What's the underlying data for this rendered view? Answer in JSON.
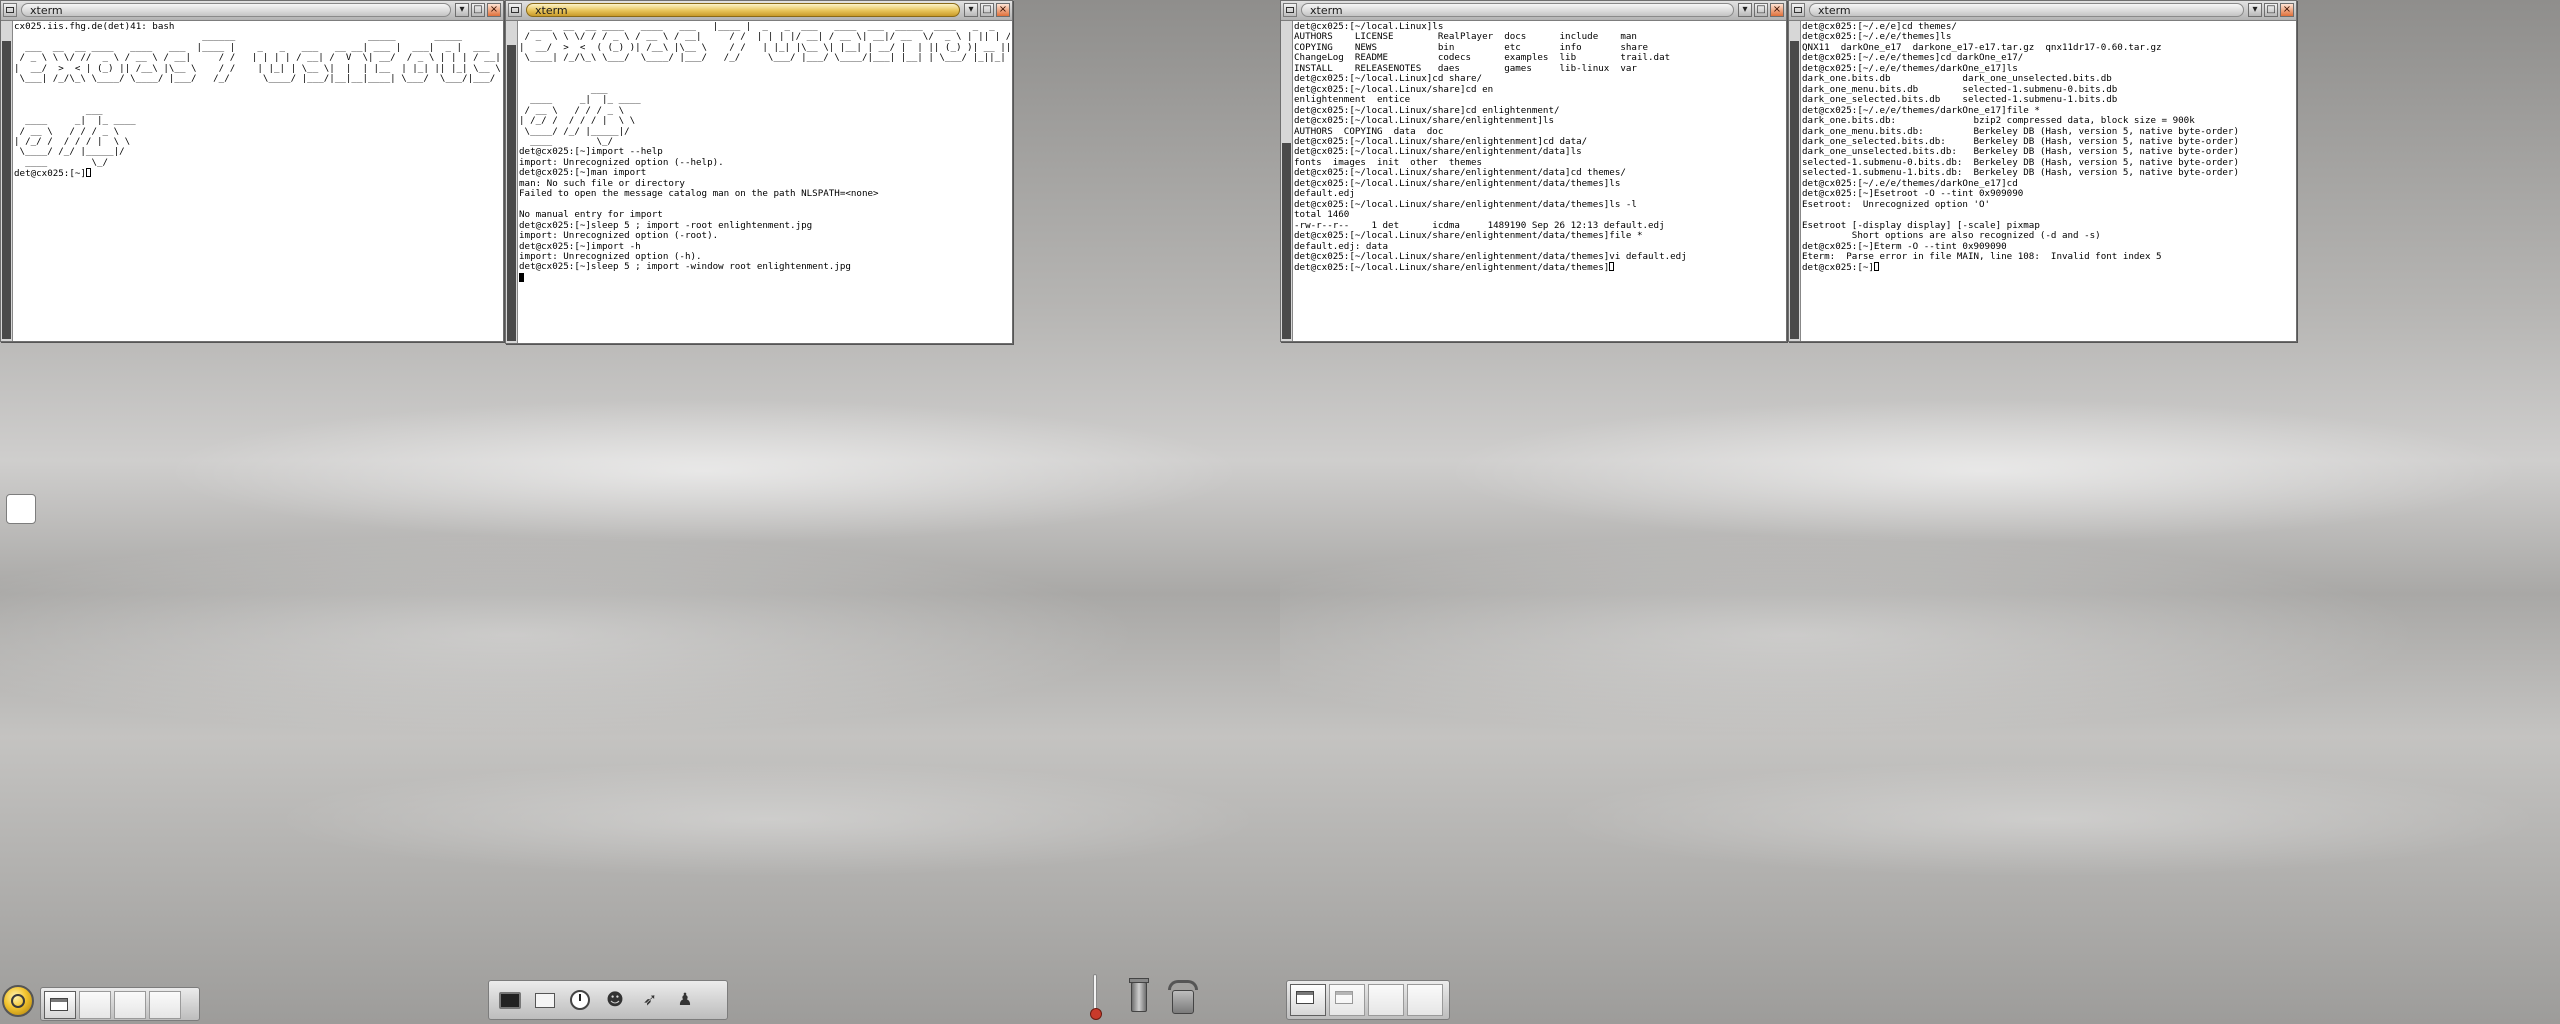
{
  "left_screen": {
    "win1": {
      "title": "xterm",
      "ascii_art": "                                  ______                        _____       _____                           \n  ___  __  __ ____   ____   ___  |____ |    _   _   ___   __ __| ___ |  ___|  _ |  ___   _  _    _____      \n / _ \\ \\ \\/ //  _ \\ / __ \\ / __|     / /   | | | | / __| /  V  \\| __/  / _ \\ | | | / __| | || |  / ___ \\    \n|  __/  >  < | (_) || /__\\ |\\__ \\    / /    | |_| | \\__ \\|  |  | |__  | |_| || |_| \\__ \\ | __ | | (___) |   \n \\___| /_/\\_\\ \\____/ \\____/ |___/   /_/      \\____/ |___/|__|__|____| \\___/  \\___/|___/ |_||_|  \\_____/    \n\n\n             ___\n  ____     _|  |_ ____\n / __ \\   / / / _ \\\n| /_/ /  / / / |  \\ \\\n \\____/ /_/ |_____|/\n  ____        \\_/",
      "lines": [
        "cx025.iis.fhg.de(det)41: bash"
      ],
      "prompt_line": "det@cx025:[~]"
    },
    "win2": {
      "title": "xterm",
      "ascii_art": "  ____  __  __ ____   ____   ___   |____ |  _   _  ___   ____  ___  _____  ____   _  _   ___ \n / _  \\ \\ \\/ / / _ \\ / __ \\ / __|     / /  | | | |/ __| / __ \\| __|/ __  \\/  _ \\ | || | / _ \\\n|  __/  >  <  ( (_) )| /__\\ |\\__ \\    / /   | |_| |\\__ \\| |__| | __/ |  | || (_) )| __ || (_) )\n \\____| /_/\\_\\ \\___/  \\____/ |___/   /_/     \\___/ |___/ \\____/|___| |__| | \\___/ |_||_| \\___/\n\n\n             ___\n  ____     _|  |_ ____\n / __ \\   / / / _ \\\n| /_/ /  / / / |  \\ \\\n \\____/ /_/ |_____|/\n  ____        \\_/",
      "lines": [
        "det@cx025:[~]import --help",
        "import: Unrecognized option (--help).",
        "det@cx025:[~]man import",
        "man: No such file or directory",
        "Failed to open the message catalog man on the path NLSPATH=<none>",
        "",
        "No manual entry for import",
        "det@cx025:[~]sleep 5 ; import -root enlightenment.jpg",
        "import: Unrecognized option (-root).",
        "det@cx025:[~]import -h",
        "import: Unrecognized option (-h).",
        "det@cx025:[~]sleep 5 ; import -window root enlightenment.jpg"
      ]
    }
  },
  "right_screen": {
    "win3": {
      "title": "xterm",
      "lines": [
        "det@cx025:[~/local.Linux]ls",
        "AUTHORS    LICENSE        RealPlayer  docs      include    man",
        "COPYING    NEWS           bin         etc       info       share",
        "ChangeLog  README         codecs      examples  lib        trail.dat",
        "INSTALL    RELEASENOTES   daes        games     lib-linux  var",
        "det@cx025:[~/local.Linux]cd share/",
        "det@cx025:[~/local.Linux/share]cd en",
        "enlightenment  entice",
        "det@cx025:[~/local.Linux/share]cd enlightenment/",
        "det@cx025:[~/local.Linux/share/enlightenment]ls",
        "AUTHORS  COPYING  data  doc",
        "det@cx025:[~/local.Linux/share/enlightenment]cd data/",
        "det@cx025:[~/local.Linux/share/enlightenment/data]ls",
        "fonts  images  init  other  themes",
        "det@cx025:[~/local.Linux/share/enlightenment/data]cd themes/",
        "det@cx025:[~/local.Linux/share/enlightenment/data/themes]ls",
        "default.edj",
        "det@cx025:[~/local.Linux/share/enlightenment/data/themes]ls -l",
        "total 1460",
        "-rw-r--r--    1 det      icdma     1489190 Sep 26 12:13 default.edj",
        "det@cx025:[~/local.Linux/share/enlightenment/data/themes]file *",
        "default.edj: data",
        "det@cx025:[~/local.Linux/share/enlightenment/data/themes]vi default.edj",
        "det@cx025:[~/local.Linux/share/enlightenment/data/themes]"
      ]
    },
    "win4": {
      "title": "xterm",
      "lines": [
        "det@cx025:[~/.e/e]cd themes/",
        "det@cx025:[~/.e/e/themes]ls",
        "QNX11  darkOne_e17  darkone_e17-e17.tar.gz  qnx11dr17-0.60.tar.gz",
        "det@cx025:[~/.e/e/themes]cd darkOne_e17/",
        "det@cx025:[~/.e/e/themes/darkOne_e17]ls",
        "dark_one.bits.db             dark_one_unselected.bits.db",
        "dark_one_menu.bits.db        selected-1.submenu-0.bits.db",
        "dark_one_selected.bits.db    selected-1.submenu-1.bits.db",
        "det@cx025:[~/.e/e/themes/darkOne_e17]file *",
        "dark_one.bits.db:              bzip2 compressed data, block size = 900k",
        "dark_one_menu.bits.db:         Berkeley DB (Hash, version 5, native byte-order)",
        "dark_one_selected.bits.db:     Berkeley DB (Hash, version 5, native byte-order)",
        "dark_one_unselected.bits.db:   Berkeley DB (Hash, version 5, native byte-order)",
        "selected-1.submenu-0.bits.db:  Berkeley DB (Hash, version 5, native byte-order)",
        "selected-1.submenu-1.bits.db:  Berkeley DB (Hash, version 5, native byte-order)",
        "det@cx025:[~/.e/e/themes/darkOne_e17]cd",
        "det@cx025:[~]Esetroot -O --tint 0x909090",
        "Esetroot:  Unrecognized option 'O'",
        "",
        "Esetroot [-display display] [-scale] pixmap",
        "         Short options are also recognized (-d and -s)",
        "det@cx025:[~]Eterm -O --tint 0x909090",
        "Eterm:  Parse error in file MAIN, line 108:  Invalid font index 5",
        "det@cx025:[~]"
      ]
    }
  },
  "taskbar": {
    "launchers": [
      "terminal-icon",
      "window-icon",
      "clock-icon",
      "chat-icon",
      "fish-icon",
      "penguin-icon"
    ],
    "gadgets": [
      "thermometer-icon",
      "trash-icon",
      "phone-icon"
    ]
  },
  "colors": {
    "active_title": "#e8c45a",
    "terminal_bg": "#ffffff",
    "terminal_fg": "#000000"
  }
}
